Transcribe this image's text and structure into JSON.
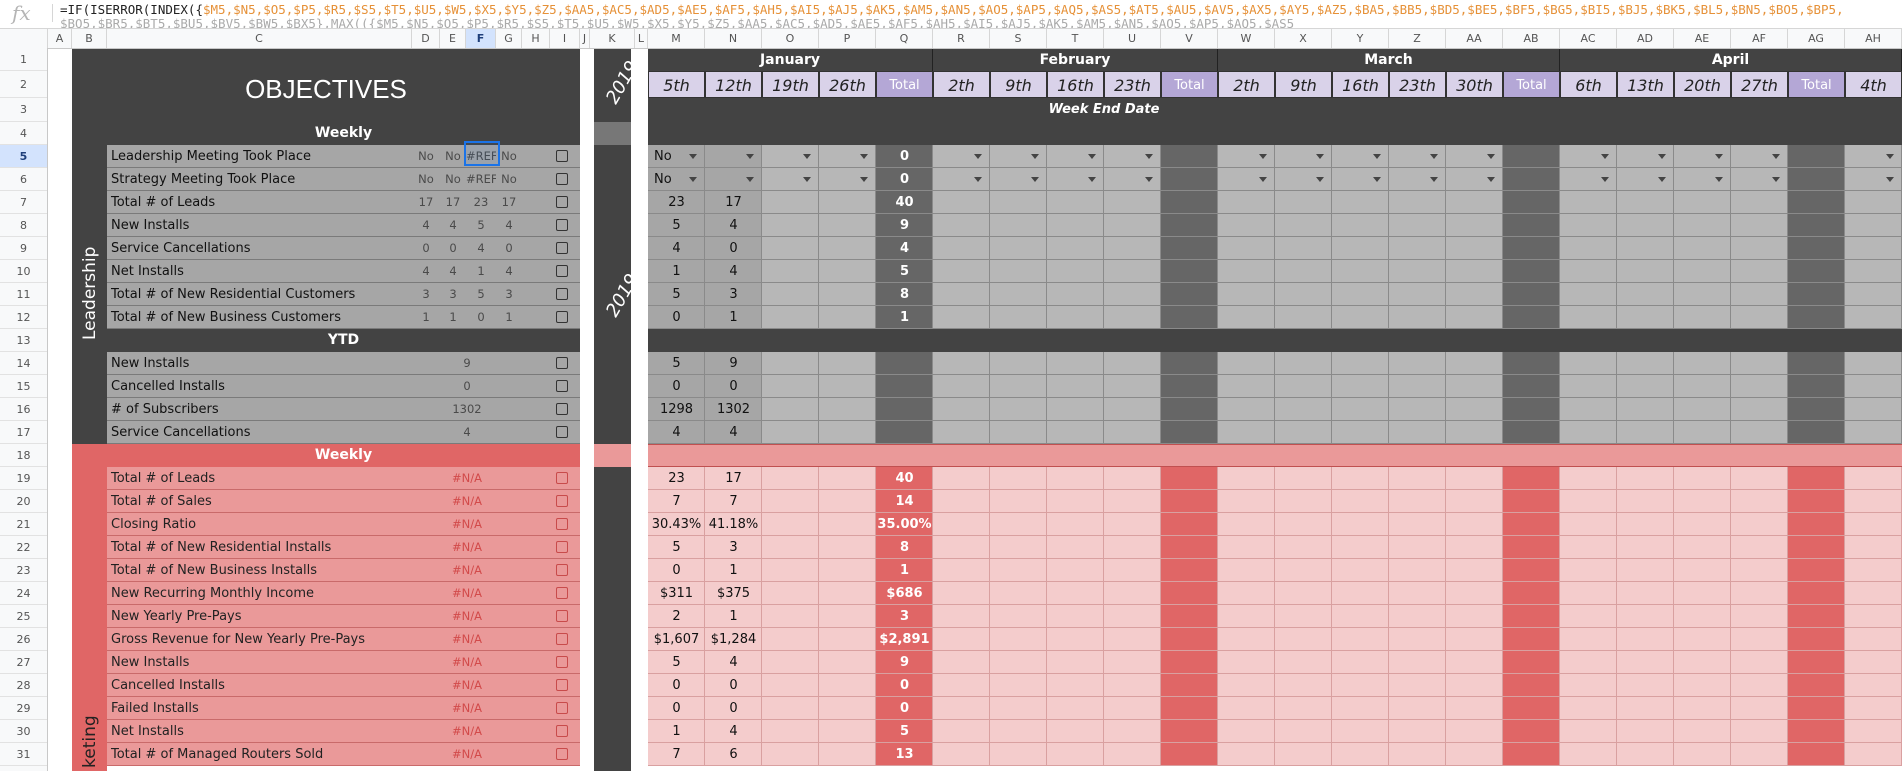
{
  "formula": {
    "fx": "fx",
    "line1_pre": "=IF(ISERROR(INDEX({",
    "line1_refs": "$M5,$N5,$O5,$P5,$R5,$S5,$T5,$U5,$W5,$X5,$Y5,$Z5,$AA5,$AC5,$AD5,$AE5,$AF5,$AH5,$AI5,$AJ5,$AK5,$AM5,$AN5,$AO5,$AP5,$AQ5,$AS5,$AT5,$AU5,$AV5,$AX5,$AY5,$AZ5,$BA5,$BB5,$BD5,$BE5,$BF5,$BG5,$BI5,$BJ5,$BK5,$BL5,$BN5,$BO5,$BP5,",
    "line2": "$BQ5,$BR5,$BT5,$BU5,$BV5,$BW5,$BX5},MAX(({$M5,$N5,$O5,$P5,$R5,$S5,$T5,$U5,$W5,$X5,$Y5,$Z5,$AA5,$AC5,$AD5,$AE5,$AF5,$AH5,$AI5,$AJ5,$AK5,$AM5,$AN5,$AO5,$AP5,$AQ5,$AS5"
  },
  "columns": [
    "A",
    "B",
    "C",
    "D",
    "E",
    "F",
    "G",
    "H",
    "I",
    "J",
    "K",
    "L",
    "M",
    "N",
    "O",
    "P",
    "Q",
    "R",
    "S",
    "T",
    "U",
    "V",
    "W",
    "X",
    "Y",
    "Z",
    "AA",
    "AB",
    "AC",
    "AD",
    "AE",
    "AF",
    "AG",
    "AH"
  ],
  "title": "OBJECTIVES",
  "year": "2019",
  "months": [
    "January",
    "February",
    "March",
    "April"
  ],
  "week_dates": [
    "5th",
    "12th",
    "19th",
    "26th",
    "Total",
    "2th",
    "9th",
    "16th",
    "23th",
    "Total",
    "2th",
    "9th",
    "16th",
    "23th",
    "30th",
    "Total",
    "6th",
    "13th",
    "20th",
    "27th",
    "Total",
    "4th"
  ],
  "week_end_label": "Week End Date",
  "sections": {
    "weekly": "Weekly",
    "ytd": "YTD",
    "leadership": "Leadership",
    "marketing_frag": "keting"
  },
  "rows": [
    {
      "n": "5",
      "label": "Leadership Meeting Took Place",
      "d": [
        "No",
        "No",
        "#REF",
        "No"
      ],
      "m": "No",
      "nn": "",
      "q": "0",
      "dd": true
    },
    {
      "n": "6",
      "label": "Strategy Meeting Took Place",
      "d": [
        "No",
        "No",
        "#REF",
        "No"
      ],
      "m": "No",
      "nn": "",
      "q": "0",
      "dd": true
    },
    {
      "n": "7",
      "label": "Total # of Leads",
      "d": [
        "17",
        "17",
        "23",
        "17"
      ],
      "m": "23",
      "nn": "17",
      "q": "40"
    },
    {
      "n": "8",
      "label": "New Installs",
      "d": [
        "4",
        "4",
        "5",
        "4"
      ],
      "m": "5",
      "nn": "4",
      "q": "9"
    },
    {
      "n": "9",
      "label": "Service Cancellations",
      "d": [
        "0",
        "0",
        "4",
        "0"
      ],
      "m": "4",
      "nn": "0",
      "q": "4"
    },
    {
      "n": "10",
      "label": "Net Installs",
      "d": [
        "4",
        "4",
        "1",
        "4"
      ],
      "m": "1",
      "nn": "4",
      "q": "5"
    },
    {
      "n": "11",
      "label": "Total # of New Residential Customers",
      "d": [
        "3",
        "3",
        "5",
        "3"
      ],
      "m": "5",
      "nn": "3",
      "q": "8"
    },
    {
      "n": "12",
      "label": "Total # of New Business Customers",
      "d": [
        "1",
        "1",
        "0",
        "1"
      ],
      "m": "0",
      "nn": "1",
      "q": "1"
    },
    {
      "n": "14",
      "label": "New Installs",
      "d": [
        "9"
      ],
      "m": "5",
      "nn": "9",
      "q": ""
    },
    {
      "n": "15",
      "label": "Cancelled Installs",
      "d": [
        "0"
      ],
      "m": "0",
      "nn": "0",
      "q": ""
    },
    {
      "n": "16",
      "label": "# of Subscribers",
      "d": [
        "1302"
      ],
      "m": "1298",
      "nn": "1302",
      "q": ""
    },
    {
      "n": "17",
      "label": "Service Cancellations",
      "d": [
        "4"
      ],
      "m": "4",
      "nn": "4",
      "q": ""
    },
    {
      "n": "19",
      "label": "Total # of Leads",
      "d": [
        "#N/A"
      ],
      "m": "23",
      "nn": "17",
      "q": "40"
    },
    {
      "n": "20",
      "label": "Total # of Sales",
      "d": [
        "#N/A"
      ],
      "m": "7",
      "nn": "7",
      "q": "14"
    },
    {
      "n": "21",
      "label": "Closing Ratio",
      "d": [
        "#N/A"
      ],
      "m": "30.43%",
      "nn": "41.18%",
      "q": "35.00%"
    },
    {
      "n": "22",
      "label": "Total # of New Residential Installs",
      "d": [
        "#N/A"
      ],
      "m": "5",
      "nn": "3",
      "q": "8"
    },
    {
      "n": "23",
      "label": "Total # of New Business Installs",
      "d": [
        "#N/A"
      ],
      "m": "0",
      "nn": "1",
      "q": "1"
    },
    {
      "n": "24",
      "label": "New Recurring Monthly Income",
      "d": [
        "#N/A"
      ],
      "m": "$311",
      "nn": "$375",
      "q": "$686"
    },
    {
      "n": "25",
      "label": "New Yearly Pre-Pays",
      "d": [
        "#N/A"
      ],
      "m": "2",
      "nn": "1",
      "q": "3"
    },
    {
      "n": "26",
      "label": "Gross Revenue for New Yearly Pre-Pays",
      "d": [
        "#N/A"
      ],
      "m": "$1,607",
      "nn": "$1,284",
      "q": "$2,891"
    },
    {
      "n": "27",
      "label": "New Installs",
      "d": [
        "#N/A"
      ],
      "m": "5",
      "nn": "4",
      "q": "9"
    },
    {
      "n": "28",
      "label": "Cancelled Installs",
      "d": [
        "#N/A"
      ],
      "m": "0",
      "nn": "0",
      "q": "0"
    },
    {
      "n": "29",
      "label": "Failed Installs",
      "d": [
        "#N/A"
      ],
      "m": "0",
      "nn": "0",
      "q": "0"
    },
    {
      "n": "30",
      "label": "Net Installs",
      "d": [
        "#N/A"
      ],
      "m": "1",
      "nn": "4",
      "q": "5"
    },
    {
      "n": "31",
      "label": "Total # of Managed Routers Sold",
      "d": [
        "#N/A"
      ],
      "m": "7",
      "nn": "6",
      "q": "13"
    }
  ],
  "section_row_numbers": {
    "r1": "1",
    "r2": "2",
    "r3": "3",
    "r4": "4",
    "r13": "13",
    "r18": "18"
  },
  "colors": {
    "dark": "#434343",
    "darker": "#3a3a3a",
    "grey_row": "#a6a6a6",
    "grey_cell": "#b7b7b7",
    "lavender": "#d9d2e9",
    "total_purple": "#b4a7d6",
    "red_header": "#e06666",
    "red_row": "#ea9999",
    "pink_cell": "#f4cccc",
    "selection": "#1a73e8"
  }
}
